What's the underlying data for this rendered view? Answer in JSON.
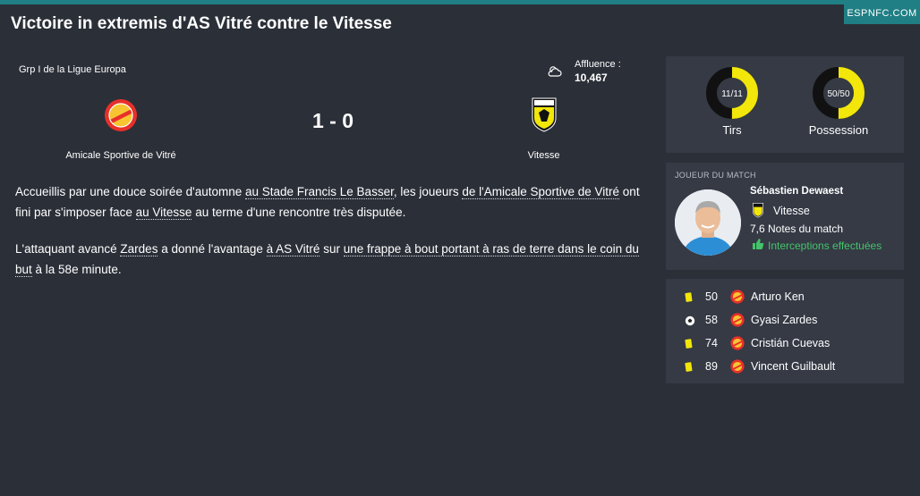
{
  "brand": "ESPNFC.COM",
  "title": "Victoire in extremis d'AS Vitré contre le Vitesse",
  "match": {
    "competition": "Grp I de la Ligue Europa",
    "attendance_label": "Affluence :",
    "attendance_value": "10,467",
    "score": "1 - 0",
    "home_team": "Amicale Sportive de Vitré",
    "away_team": "Vitesse"
  },
  "article": {
    "p1": [
      {
        "t": "Accueillis par une douce soirée d'automne ",
        "link": false
      },
      {
        "t": "au Stade Francis Le Basser",
        "link": true
      },
      {
        "t": ", les joueurs ",
        "link": false
      },
      {
        "t": "de l'Amicale Sportive de Vitré",
        "link": true
      },
      {
        "t": " ont fini par s'imposer face ",
        "link": false
      },
      {
        "t": "au Vitesse",
        "link": true
      },
      {
        "t": " au terme d'une rencontre très disputée.",
        "link": false
      }
    ],
    "p2": [
      {
        "t": "L'attaquant avancé ",
        "link": false
      },
      {
        "t": "Zardes",
        "link": true
      },
      {
        "t": " a donné l'avantage ",
        "link": false
      },
      {
        "t": "à AS Vitré",
        "link": true
      },
      {
        "t": " sur ",
        "link": false
      },
      {
        "t": "une frappe à bout portant à ras de terre dans le coin du but",
        "link": true
      },
      {
        "t": " à la 58e minute.",
        "link": false
      }
    ]
  },
  "stats": {
    "shots": {
      "label": "Tirs",
      "value_text": "11/11",
      "home_share": 0.5
    },
    "possession": {
      "label": "Possession",
      "value_text": "50/50",
      "home_share": 0.5
    },
    "colors": {
      "home": "#f2e60a",
      "away": "#111111"
    }
  },
  "motm": {
    "heading": "JOUEUR DU MATCH",
    "name": "Sébastien Dewaest",
    "club": "Vitesse",
    "rating": "7,6",
    "rating_label": "Notes du match",
    "stat": "Interceptions effectuées",
    "stat_color": "#44c46a"
  },
  "events": [
    {
      "type": "yellow-card",
      "minute": "50",
      "player": "Arturo Ken"
    },
    {
      "type": "goal",
      "minute": "58",
      "player": "Gyasi Zardes"
    },
    {
      "type": "yellow-card",
      "minute": "74",
      "player": "Cristián Cuevas"
    },
    {
      "type": "yellow-card",
      "minute": "89",
      "player": "Vincent Guilbault"
    }
  ],
  "colors": {
    "background": "#2b2f38",
    "panel": "#353a45",
    "accent": "#1f7f84",
    "link_underline": "#d9dde3"
  }
}
